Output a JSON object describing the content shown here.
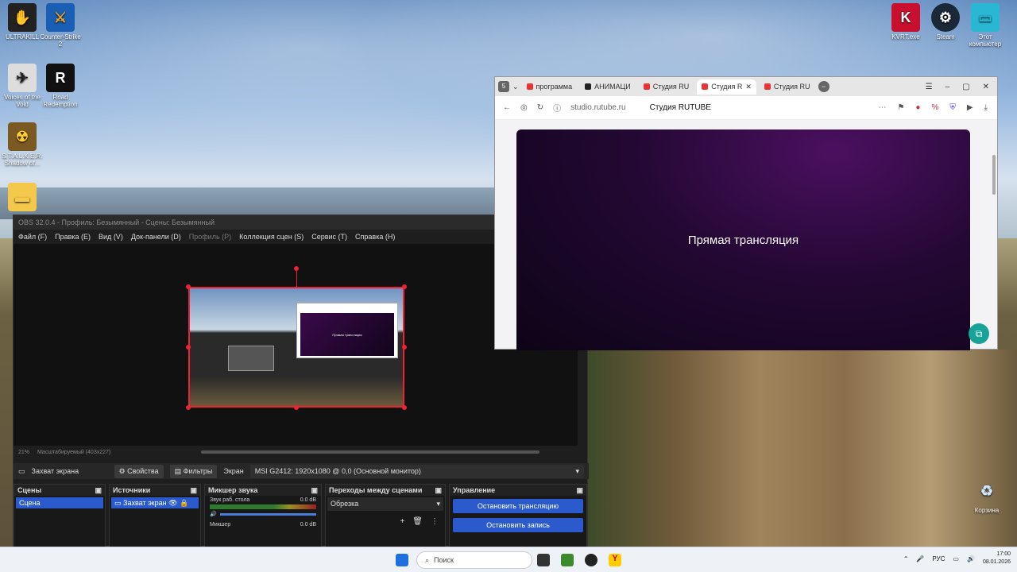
{
  "desktop": {
    "icons": [
      {
        "label": "ULTRAKILL",
        "icon": "ultrakill-icon",
        "glyph": "✋"
      },
      {
        "label": "Counter-Strike 2",
        "icon": "counter-strike-icon",
        "glyph": "⚔"
      },
      {
        "label": "Voices of the Void",
        "icon": "voices-of-the-void-icon",
        "glyph": "✈"
      },
      {
        "label": "Road Redemption",
        "icon": "road-redemption-icon",
        "glyph": "R"
      },
      {
        "label": "S.T.A.L.K.E.R. Shadow of...",
        "icon": "stalker-icon",
        "glyph": "☢"
      },
      {
        "label": "KVRT.exe",
        "icon": "kaspersky-icon",
        "glyph": "K"
      },
      {
        "label": "Steam",
        "icon": "steam-icon",
        "glyph": "⚙"
      },
      {
        "label": "Этот компьютер",
        "icon": "this-pc-icon",
        "glyph": "▭"
      },
      {
        "label": "Корзина",
        "icon": "recycle-bin-icon",
        "glyph": "♻"
      }
    ]
  },
  "obs": {
    "title": "OBS 32.0.4 - Профиль: Безымянный - Сцены: Безымянный",
    "menu": [
      "Файл (F)",
      "Правка (E)",
      "Вид (V)",
      "Док-панели (D)",
      "Профиль (P)",
      "Коллекция сцен (S)",
      "Сервис (T)",
      "Справка (H)"
    ],
    "preview_mini_text": "Прямая трансляция",
    "status": {
      "zoom": "21%",
      "scale": "Масштабируемый (403x227)"
    },
    "toolbar": {
      "source_name": "Захват экрана",
      "properties": "Свойства",
      "filters": "Фильтры",
      "screen_label": "Экран",
      "screen_value": "MSI G2412: 1920x1080 @ 0,0 (Основной монитор)"
    },
    "docks": {
      "scenes": {
        "title": "Сцены",
        "items": [
          "Сцена"
        ]
      },
      "sources": {
        "title": "Источники",
        "items": [
          "Захват экран"
        ]
      },
      "mixer": {
        "title": "Микшер звука",
        "channel": "Звук раб. стола",
        "level": "0.0 dB",
        "channel2": "Микшер",
        "level2": "0.0 dB"
      },
      "transitions": {
        "title": "Переходы между сценами",
        "selected": "Обрезка"
      },
      "controls": {
        "title": "Управление",
        "stop_stream": "Остановить трансляцию",
        "stop_record": "Остановить запись"
      }
    }
  },
  "browser": {
    "tabs": [
      "программа",
      "АНИМАЦИ",
      "Студия RU",
      "Студия R",
      "Студия RU"
    ],
    "url": "studio.rutube.ru",
    "page_title": "Студия RUTUBE",
    "player_text": "Прямая трансляция"
  },
  "taskbar": {
    "search_placeholder": "Поиск",
    "lang": "РУС",
    "time": "17:00",
    "date": "08.01.2026"
  }
}
